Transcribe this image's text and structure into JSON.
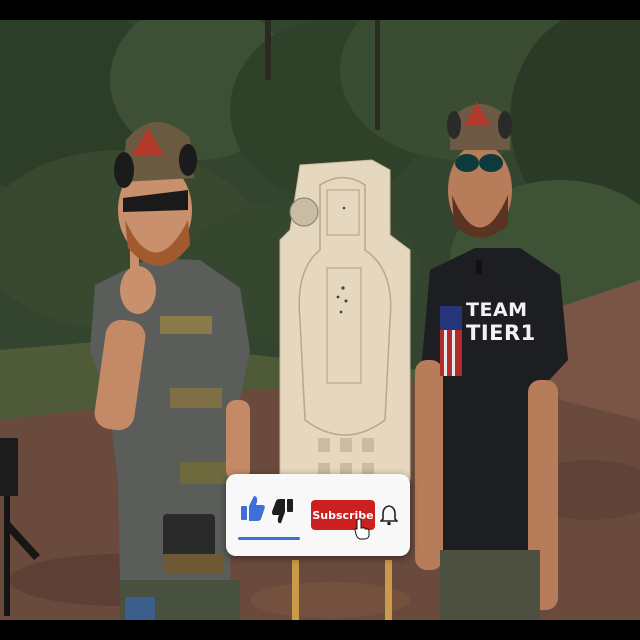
{
  "scene": {
    "left_person": "man with beard, cap, ear protection, pointing finger",
    "right_person": "man with beard, cap, sunglasses, ear protection",
    "target": "paper silhouette target on stakes"
  },
  "shirt": {
    "line1": "TEAM",
    "line2": "TIER1"
  },
  "overlay": {
    "subscribe_label": "Subscribe",
    "like_icon": "thumbs-up-icon",
    "dislike_icon": "thumbs-down-icon",
    "bell_icon": "bell-icon",
    "cursor_icon": "hand-pointer-icon",
    "accent_color": "#cc1f1f",
    "like_color": "#3d6fd6"
  }
}
